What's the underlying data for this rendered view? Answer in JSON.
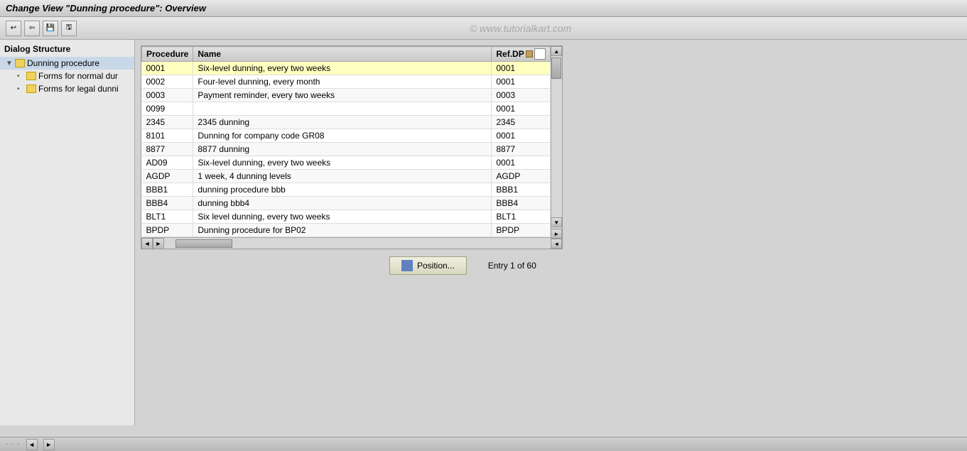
{
  "title": "Change View \"Dunning procedure\": Overview",
  "toolbar": {
    "buttons": [
      "undo-icon",
      "back-icon",
      "save-icon",
      "save-local-icon",
      "print-icon"
    ]
  },
  "watermark": "© www.tutorialkart.com",
  "sidebar": {
    "title": "Dialog Structure",
    "items": [
      {
        "label": "Dunning procedure",
        "level": 1,
        "expanded": true,
        "selected": true
      },
      {
        "label": "Forms for normal dur",
        "level": 2
      },
      {
        "label": "Forms for legal dunni",
        "level": 2
      }
    ]
  },
  "table": {
    "columns": [
      {
        "key": "procedure",
        "label": "Procedure"
      },
      {
        "key": "name",
        "label": "Name"
      },
      {
        "key": "refdp",
        "label": "Ref.DP"
      }
    ],
    "rows": [
      {
        "procedure": "0001",
        "name": "Six-level dunning, every two weeks",
        "refdp": "0001",
        "highlighted": true
      },
      {
        "procedure": "0002",
        "name": "Four-level dunning, every month",
        "refdp": "0001"
      },
      {
        "procedure": "0003",
        "name": "Payment reminder, every two weeks",
        "refdp": "0003"
      },
      {
        "procedure": "0099",
        "name": "",
        "refdp": "0001"
      },
      {
        "procedure": "2345",
        "name": "2345 dunning",
        "refdp": "2345"
      },
      {
        "procedure": "8101",
        "name": "Dunning for company code GR08",
        "refdp": "0001"
      },
      {
        "procedure": "8877",
        "name": "8877 dunning",
        "refdp": "8877"
      },
      {
        "procedure": "AD09",
        "name": "Six-level dunning, every two weeks",
        "refdp": "0001"
      },
      {
        "procedure": "AGDP",
        "name": "1 week, 4 dunning levels",
        "refdp": "AGDP"
      },
      {
        "procedure": "BBB1",
        "name": "dunning procedure bbb",
        "refdp": "BBB1"
      },
      {
        "procedure": "BBB4",
        "name": "dunning bbb4",
        "refdp": "BBB4"
      },
      {
        "procedure": "BLT1",
        "name": "Six level dunning, every two weeks",
        "refdp": "BLT1"
      },
      {
        "procedure": "BPDP",
        "name": "Dunning procedure for BP02",
        "refdp": "BPDP"
      }
    ]
  },
  "position_button": "Position...",
  "entry_text": "Entry 1 of 60",
  "status_dots": "...",
  "nav_left": "◄",
  "nav_right": "►"
}
